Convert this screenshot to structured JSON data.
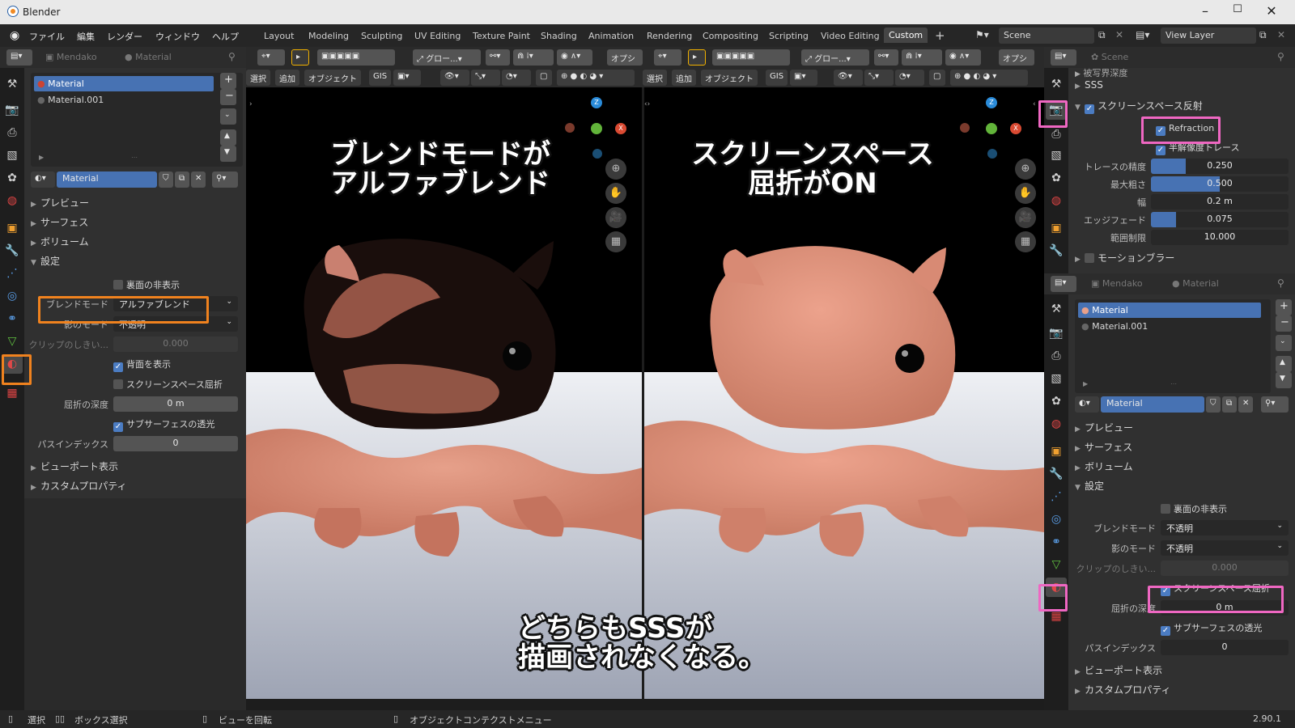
{
  "app_title": "Blender",
  "version": "2.90.1",
  "menu": [
    "ファイル",
    "編集",
    "レンダー",
    "ウィンドウ",
    "ヘルプ"
  ],
  "workspaces": [
    "Layout",
    "Modeling",
    "Sculpting",
    "UV Editing",
    "Texture Paint",
    "Shading",
    "Animation",
    "Rendering",
    "Compositing",
    "Scripting",
    "Video Editing",
    "Custom"
  ],
  "scene_name": "Scene",
  "view_layer": "View Layer",
  "left_panel": {
    "breadcrumb_obj": "Mendako",
    "breadcrumb_mat": "Material",
    "slots": [
      "Material",
      "Material.001"
    ],
    "material_name": "Material",
    "sections": {
      "preview": "プレビュー",
      "surface": "サーフェス",
      "volume": "ボリューム",
      "settings": "設定",
      "viewport": "ビューポート表示",
      "custom": "カスタムプロパティ"
    },
    "backface_culling": "裏面の非表示",
    "blend_mode_label": "ブレンドモード",
    "blend_mode_value": "アルファブレンド",
    "shadow_mode_label": "影のモード",
    "shadow_mode_value": "不透明",
    "clip_label": "クリップのしきい...",
    "clip_value": "0.000",
    "show_backface": "背面を表示",
    "ss_refraction": "スクリーンスペース屈折",
    "refraction_depth_label": "屈折の深度",
    "refraction_depth_value": "0 m",
    "sss_translucency": "サブサーフェスの透光",
    "pass_index_label": "パスインデックス",
    "pass_index_value": "0"
  },
  "viewport_header": {
    "select": "選択",
    "add": "追加",
    "object": "オブジェクト",
    "gis": "GIS",
    "global": "グロー...",
    "options": "オプシ"
  },
  "overlays": {
    "left": [
      "ブレンドモードが",
      "アルファブレンド"
    ],
    "right": [
      "スクリーンスペース",
      "屈折がON"
    ],
    "bottom": [
      "どちらもSSSが",
      "描画されなくなる。"
    ]
  },
  "right_top": {
    "scene_crumb": "Scene",
    "partial": "被写界深度",
    "sss": "SSS",
    "ssr": "スクリーンスペース反射",
    "refraction": "Refraction",
    "half_res": "半解像度トレース",
    "rows": [
      {
        "label": "トレースの精度",
        "value": "0.250",
        "fill": 0.25
      },
      {
        "label": "最大粗さ",
        "value": "0.500",
        "fill": 0.5
      },
      {
        "label": "幅",
        "value": "0.2 m",
        "fill": 0
      },
      {
        "label": "エッジフェード",
        "value": "0.075",
        "fill": 0.075
      },
      {
        "label": "範囲制限",
        "value": "10.000",
        "fill": 0
      }
    ],
    "motion_blur": "モーションブラー"
  },
  "right_bottom": {
    "breadcrumb_obj": "Mendako",
    "breadcrumb_mat": "Material",
    "slots": [
      "Material",
      "Material.001"
    ],
    "material_name": "Material",
    "sections": {
      "preview": "プレビュー",
      "surface": "サーフェス",
      "volume": "ボリューム",
      "settings": "設定",
      "viewport": "ビューポート表示",
      "custom": "カスタムプロパティ"
    },
    "backface_culling": "裏面の非表示",
    "blend_mode_label": "ブレンドモード",
    "blend_mode_value": "不透明",
    "shadow_mode_label": "影のモード",
    "shadow_mode_value": "不透明",
    "clip_label": "クリップのしきい...",
    "clip_value": "0.000",
    "ss_refraction": "スクリーンスペース屈折",
    "refraction_depth_label": "屈折の深度",
    "refraction_depth_value": "0 m",
    "sss_translucency": "サブサーフェスの透光",
    "pass_index_label": "パスインデックス",
    "pass_index_value": "0"
  },
  "status": {
    "select": "選択",
    "box_select": "ボックス選択",
    "rotate_view": "ビューを回転",
    "context_menu": "オブジェクトコンテクストメニュー"
  },
  "colors": {
    "highlight_orange": "#f0821e",
    "highlight_pink": "#ef67c2",
    "accent_blue": "#4772b3",
    "octopus": "#d98a72"
  }
}
